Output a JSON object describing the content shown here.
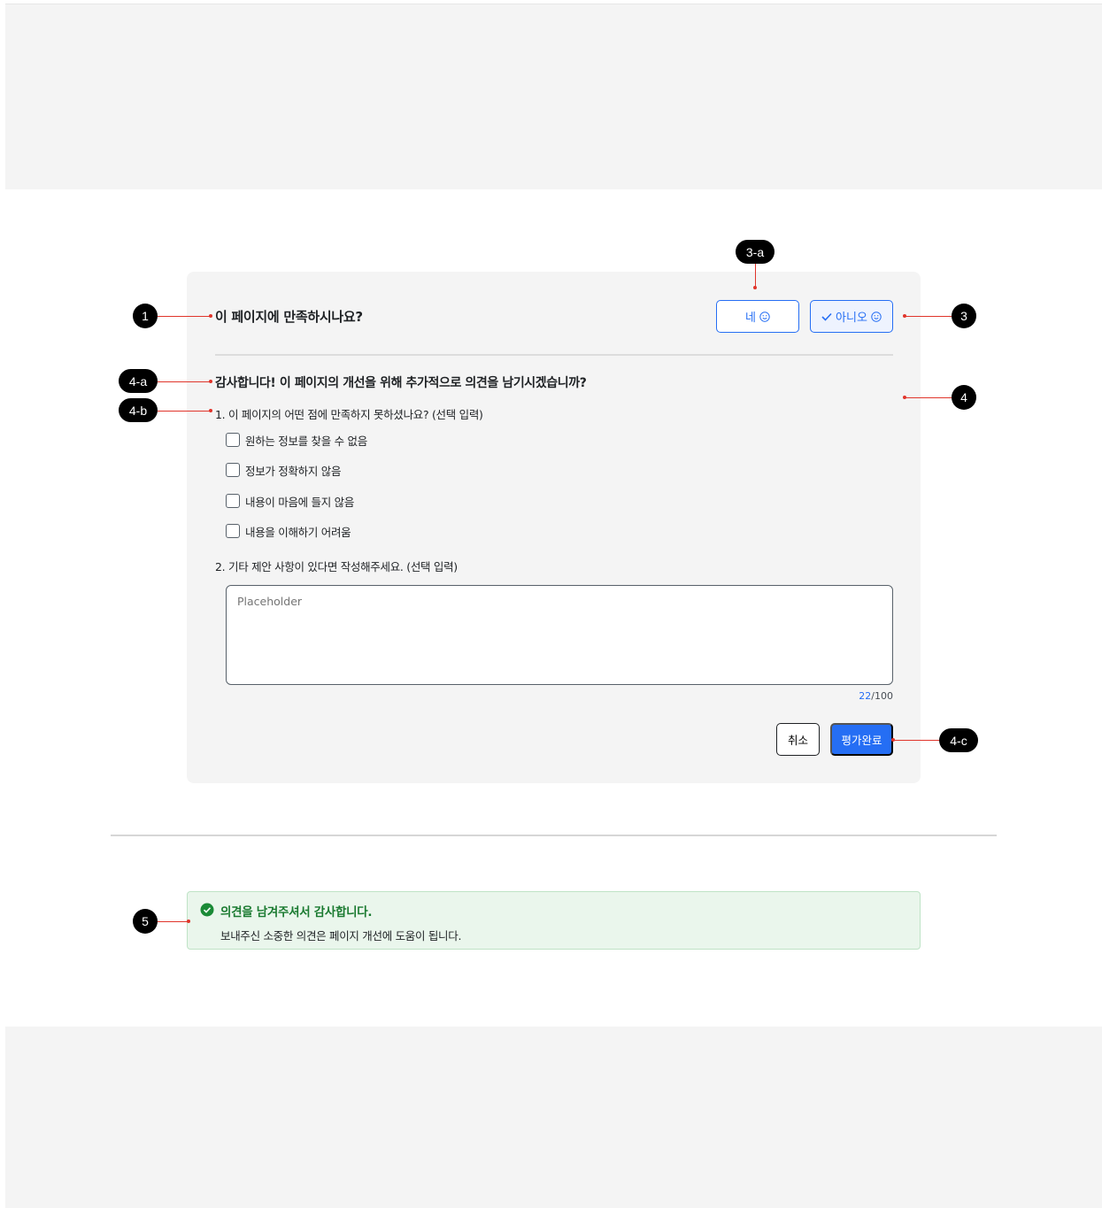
{
  "survey": {
    "question": "이 페이지에 만족하시나요?",
    "yes_label": "네",
    "no_label": "아니오",
    "followup_title": "감사합니다! 이 페이지의 개선을 위해 추가적으로 의견을 남기시겠습니까?",
    "q1": "1. 이 페이지의 어떤 점에 만족하지 못하셨나요? (선택 입력)",
    "options": [
      "원하는 정보를 찾을 수 없음",
      "정보가 정확하지 않음",
      "내용이 마음에 들지 않음",
      "내용을 이해하기 어려움"
    ],
    "q2": "2. 기타 제안 사항이 있다면 작성해주세요. (선택 입력)",
    "textarea_placeholder": "Placeholder",
    "char_count_current": "22",
    "char_count_max": "/100",
    "cancel_label": "취소",
    "submit_label": "평가완료"
  },
  "toast": {
    "title": "의견을 남겨주셔서 감사합니다.",
    "description": "보내주신 소중한 의견은 페이지 개선에 도움이 됩니다."
  },
  "annotations": {
    "m1": "1",
    "m3": "3",
    "m3a": "3-a",
    "m4": "4",
    "m4a": "4-a",
    "m4b": "4-b",
    "m4c": "4-c",
    "m5": "5"
  },
  "colors": {
    "primary": "#256ef4",
    "success": "#1a7a30",
    "annotation_line": "#e0352b"
  }
}
